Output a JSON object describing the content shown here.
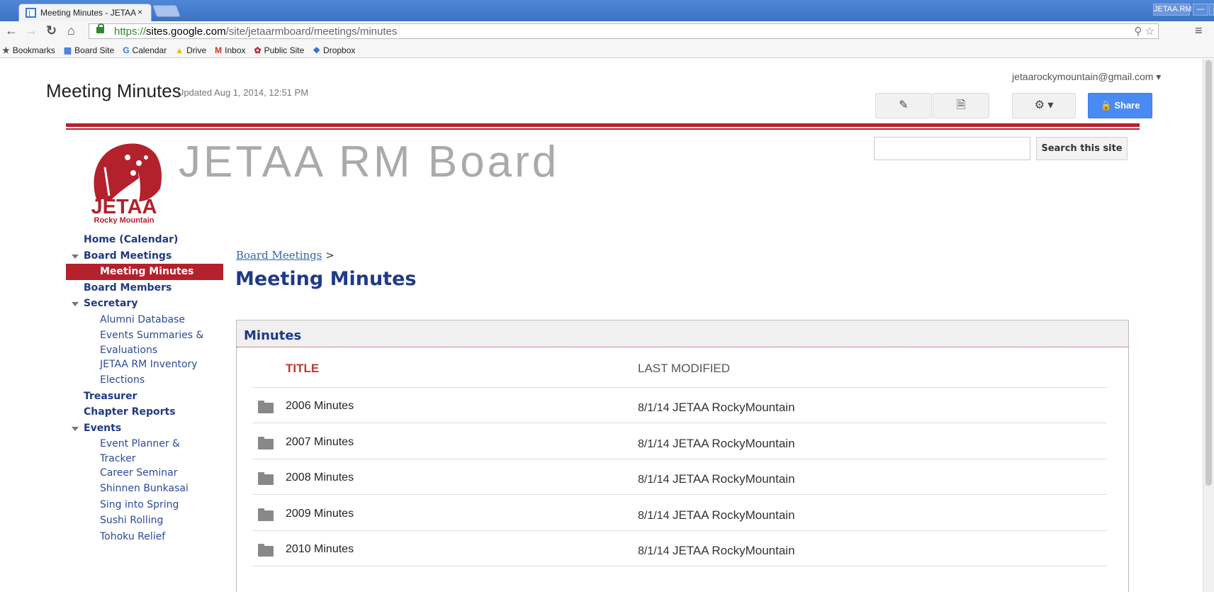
{
  "browser": {
    "tab_title": "Meeting Minutes - JETAA",
    "tab_close": "×",
    "window_label": "JETAA.RM",
    "url": {
      "protocol": "https://",
      "host": "sites.google.com",
      "path": "/site/jetaarmboard/meetings/minutes"
    },
    "bookmarks": [
      {
        "icon": "star-icon",
        "label": "Bookmarks"
      },
      {
        "icon": "google-sites-icon",
        "label": "Board Site"
      },
      {
        "icon": "google-calendar-icon",
        "label": "Calendar"
      },
      {
        "icon": "google-drive-icon",
        "label": "Drive"
      },
      {
        "icon": "gmail-icon",
        "label": "Inbox"
      },
      {
        "icon": "jetaa-icon",
        "label": "Public Site"
      },
      {
        "icon": "dropbox-icon",
        "label": "Dropbox"
      }
    ]
  },
  "header": {
    "page_title": "Meeting Minutes",
    "updated": "Updated Aug 1, 2014, 12:51 PM",
    "user_email": "jetaarockymountain@gmail.com",
    "share_label": "Share"
  },
  "site": {
    "title": "JETAA RM Board",
    "search_button": "Search this site",
    "logo_text": "JETAA",
    "logo_subtext": "Rocky Mountain",
    "brand_color": "#b3212c"
  },
  "sidebar": {
    "items": [
      {
        "label": "Home (Calendar)",
        "level": "top",
        "expanded": false
      },
      {
        "label": "Board Meetings",
        "level": "top",
        "expanded": true
      },
      {
        "label": "Meeting Minutes",
        "level": "sub",
        "active": true
      },
      {
        "label": "Board Members",
        "level": "top",
        "expanded": false
      },
      {
        "label": "Secretary",
        "level": "top",
        "expanded": true
      },
      {
        "label": "Alumni Database",
        "level": "sub"
      },
      {
        "label": "Events Summaries &",
        "level": "sub"
      },
      {
        "label": "Evaluations",
        "level": "sub2"
      },
      {
        "label": "JETAA RM Inventory",
        "level": "sub"
      },
      {
        "label": "Elections",
        "level": "sub"
      },
      {
        "label": "Treasurer",
        "level": "top"
      },
      {
        "label": "Chapter Reports",
        "level": "top"
      },
      {
        "label": "Events",
        "level": "top",
        "expanded": true
      },
      {
        "label": "Event Planner &",
        "level": "sub"
      },
      {
        "label": "Tracker",
        "level": "sub2"
      },
      {
        "label": "Career Seminar",
        "level": "sub"
      },
      {
        "label": "Shinnen Bunkasai",
        "level": "sub"
      },
      {
        "label": "Sing into Spring",
        "level": "sub"
      },
      {
        "label": "Sushi Rolling",
        "level": "sub"
      },
      {
        "label": "Tohoku Relief",
        "level": "sub"
      }
    ]
  },
  "main": {
    "breadcrumb_link": "Board Meetings",
    "breadcrumb_sep": ">",
    "heading": "Meeting Minutes",
    "cabinet_title": "Minutes",
    "columns": [
      "TITLE",
      "LAST MODIFIED"
    ],
    "rows": [
      {
        "title": "2006 Minutes",
        "date": "8/1/14",
        "author": "JETAA RockyMountain"
      },
      {
        "title": "2007 Minutes",
        "date": "8/1/14",
        "author": "JETAA RockyMountain"
      },
      {
        "title": "2008 Minutes",
        "date": "8/1/14",
        "author": "JETAA RockyMountain"
      },
      {
        "title": "2009 Minutes",
        "date": "8/1/14",
        "author": "JETAA RockyMountain"
      },
      {
        "title": "2010 Minutes",
        "date": "8/1/14",
        "author": "JETAA RockyMountain"
      }
    ]
  }
}
